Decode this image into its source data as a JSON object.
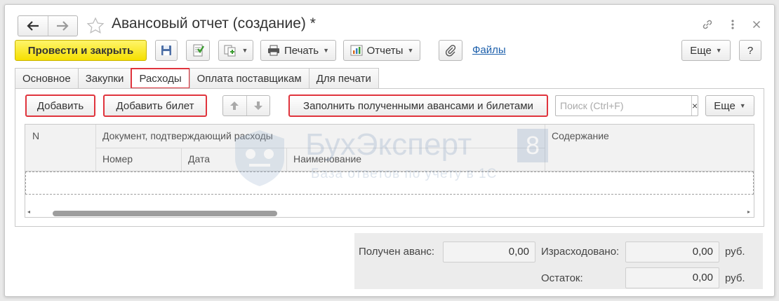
{
  "window": {
    "title": "Авансовый отчет (создание) *"
  },
  "icons": {
    "back": "arrow-left-icon",
    "forward": "arrow-right-icon",
    "favorite": "star-icon",
    "link": "link-icon",
    "menu": "more-vertical-icon",
    "close": "close-icon"
  },
  "toolbar": {
    "post_close": "Провести и закрыть",
    "print": "Печать",
    "reports": "Отчеты",
    "files": "Файлы",
    "more": "Еще",
    "help": "?"
  },
  "tabs": [
    {
      "label": "Основное",
      "active": false
    },
    {
      "label": "Закупки",
      "active": false
    },
    {
      "label": "Расходы",
      "active": true
    },
    {
      "label": "Оплата поставщикам",
      "active": false
    },
    {
      "label": "Для печати",
      "active": false
    }
  ],
  "expenses": {
    "add": "Добавить",
    "add_ticket": "Добавить билет",
    "fill": "Заполнить полученными авансами и билетами",
    "search_placeholder": "Поиск (Ctrl+F)",
    "search_clear": "×",
    "more": "Еще"
  },
  "table": {
    "col_n": "N",
    "col_document": "Документ, подтверждающий расходы",
    "col_number": "Номер",
    "col_date": "Дата",
    "col_name": "Наименование",
    "col_content": "Содержание",
    "rows": []
  },
  "watermark": {
    "brand": "БухЭксперт",
    "digit": "8",
    "tagline": "База ответов по учету в 1С"
  },
  "colors": {
    "accent_yellow": "#f5df00",
    "highlight_red": "#e0343d",
    "link_blue": "#1c5fab"
  },
  "totals": {
    "advance_label": "Получен аванс:",
    "advance_value": "0,00",
    "spent_label": "Израсходовано:",
    "spent_value": "0,00",
    "spent_currency": "руб.",
    "remainder_label": "Остаток:",
    "remainder_value": "0,00",
    "remainder_currency": "руб."
  }
}
